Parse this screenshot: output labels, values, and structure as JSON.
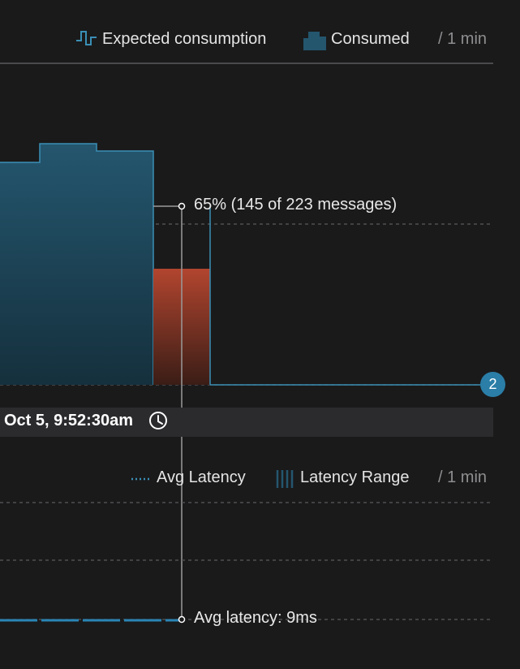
{
  "colors": {
    "background": "#1a1a1b",
    "consumed_fill_top": "#24566e",
    "consumed_fill_bottom": "#15303d",
    "expected_line": "#3a8fb5",
    "overrun_fill_top": "#b2452f",
    "overrun_fill_bottom": "#3a1d16",
    "latency_line": "#2a85b5",
    "gridline": "#5a5a5c",
    "crosshair": "#9a9a9a",
    "badge": "#2a7ea7"
  },
  "consumption_chart": {
    "legend": {
      "expected_label": "Expected consumption",
      "expected_icon": "step-line-icon",
      "consumed_label": "Consumed",
      "consumed_icon": "step-area-icon",
      "interval": "/ 1 min"
    },
    "tooltip": {
      "percentage_label": "65% (145 of 223 messages)"
    },
    "badge_count": "2"
  },
  "time_axis": {
    "timestamp": "Oct 5, 9:52:30am",
    "clock_icon": "clock-icon"
  },
  "latency_chart": {
    "legend": {
      "avg_label": "Avg Latency",
      "avg_icon": "dotted-line-icon",
      "range_label": "Latency Range",
      "range_icon": "striped-bar-icon",
      "interval": "/ 1 min"
    },
    "tooltip": {
      "avg_latency_label": "Avg latency: 9ms"
    }
  }
}
